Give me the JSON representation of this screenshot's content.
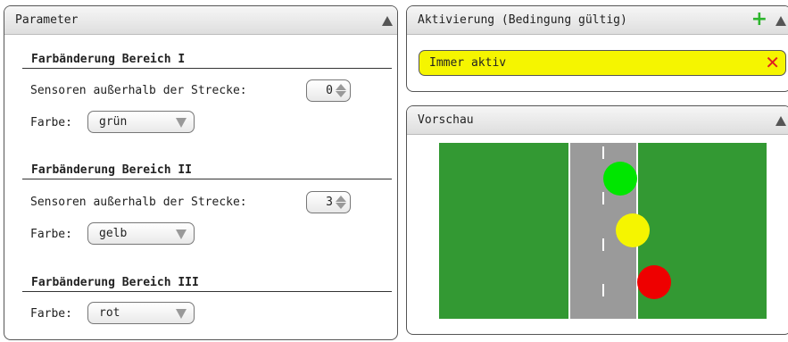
{
  "parameter": {
    "title": "Parameter",
    "sections": [
      {
        "heading": "Farbänderung Bereich I",
        "sensor_label": "Sensoren außerhalb der Strecke:",
        "sensor_value": "0",
        "color_label": "Farbe:",
        "color_value": "grün"
      },
      {
        "heading": "Farbänderung Bereich II",
        "sensor_label": "Sensoren außerhalb der Strecke:",
        "sensor_value": "3",
        "color_label": "Farbe:",
        "color_value": "gelb"
      },
      {
        "heading": "Farbänderung Bereich III",
        "color_label": "Farbe:",
        "color_value": "rot"
      }
    ]
  },
  "activation": {
    "title": "Aktivierung (Bedingung gültig)",
    "add_icon": "plus-icon",
    "condition": "Immer aktiv",
    "remove_icon": "close-icon"
  },
  "preview": {
    "title": "Vorschau",
    "colors": {
      "grass": "#339933",
      "road": "#9a9a9a",
      "green": "#00e600",
      "yellow": "#f5f500",
      "red": "#ee0000"
    }
  },
  "colors": {
    "condition_bg": "#f5f500",
    "add": "#2db52d",
    "remove": "#e02020"
  }
}
